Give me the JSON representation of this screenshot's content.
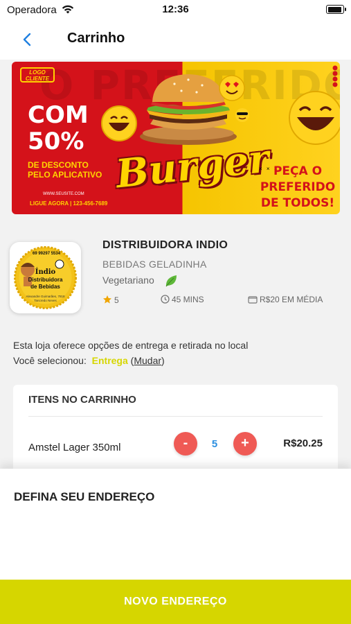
{
  "status_bar": {
    "carrier": "Operadora",
    "time": "12:36",
    "battery_level": 0.95
  },
  "nav": {
    "title": "Carrinho",
    "back_icon": "chevron-left-icon"
  },
  "banner": {
    "logo_text": "LOGO CLIENTE",
    "background_word": "O PREFERIDO",
    "promo_line1": "COM",
    "promo_line2": "50%",
    "promo_sub1": "DE DESCONTO",
    "promo_sub2": "PELO APLICATIVO",
    "website": "WWW.SEUSITE.COM",
    "phone": "LIGUE AGORA | 123-456-7689",
    "brand_word": "Burger",
    "cta_line1": "PEÇA O",
    "cta_line2": "PREFERIDO",
    "cta_line3": "DE TODOS!",
    "colors": {
      "red": "#d4121a",
      "yellow": "#f5c400"
    }
  },
  "store": {
    "name": "DISTRIBUIDORA INDIO",
    "subtitle": "BEBIDAS GELADINHA",
    "category": "Vegetariano",
    "category_icon": "leaf-icon",
    "rating": "5",
    "delivery_time": "45 MINS",
    "avg_price": "R$20 EM MÉDIA",
    "logo": {
      "phone": "69 99297 5534",
      "line1": "Índio",
      "line2": "Distribuidora",
      "line3": "de Bebidas",
      "address1": "Alexandre Guimarães, 7818",
      "address2": "Tancredo Neves"
    }
  },
  "delivery": {
    "info": "Esta loja oferece opções de entrega e retirada no local",
    "selected_label": "Você selecionou:",
    "selected_value": "Entrega",
    "change_open": "(",
    "change_link": "Mudar",
    "change_close": ")"
  },
  "cart": {
    "title": "ITENS NO CARRINHO",
    "items": [
      {
        "name": "Amstel Lager 350ml",
        "quantity": "5",
        "price": "R$20.25",
        "minus": "-",
        "plus": "+"
      }
    ]
  },
  "address_sheet": {
    "title": "DEFINA SEU ENDEREÇO",
    "button_label": "NOVO ENDEREÇO",
    "accent": "#d6d600"
  }
}
